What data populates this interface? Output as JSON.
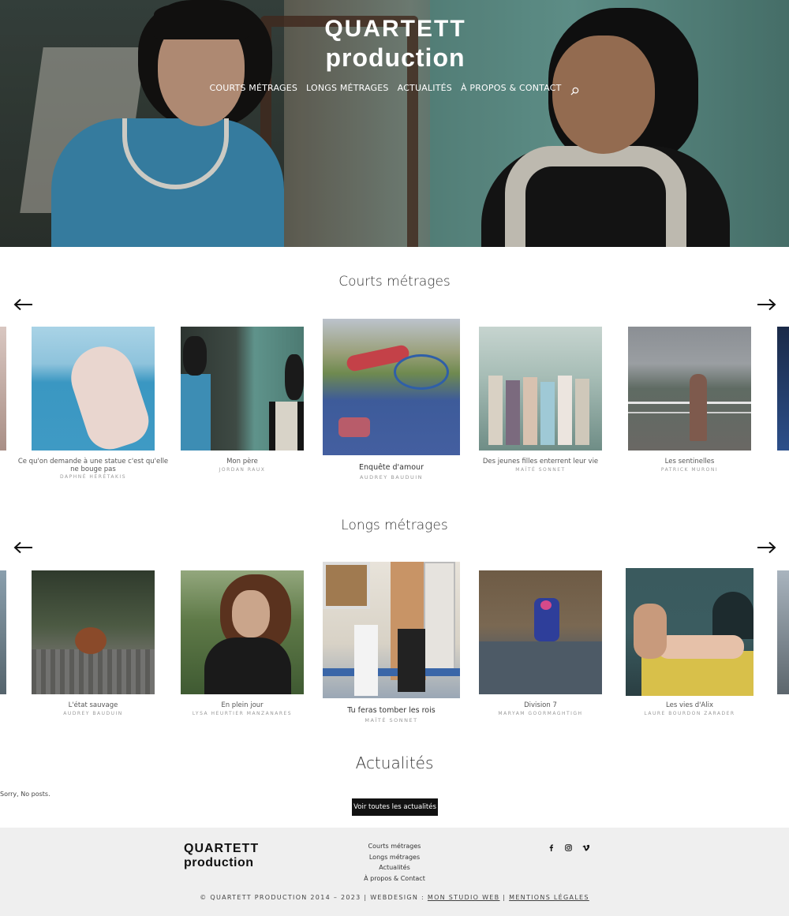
{
  "brand": {
    "line1": "QUARTETT",
    "line2": "production"
  },
  "nav": {
    "items": [
      "COURTS MÉTRAGES",
      "LONGS MÉTRAGES",
      "ACTUALITÉS",
      "À PROPOS & CONTACT"
    ]
  },
  "courts": {
    "title": "Courts métrages",
    "films": [
      {
        "title": "Ce qu'on demande à une statue c'est qu'elle ne bouge pas",
        "author": "DAPHNÉ HÉRÉTAKIS"
      },
      {
        "title": "Mon père",
        "author": "JORDAN RAUX"
      },
      {
        "title": "Enquête d'amour",
        "author": "AUDREY BAUDUIN"
      },
      {
        "title": "Des jeunes filles enterrent leur vie",
        "author": "MAÏTÉ SONNET"
      },
      {
        "title": "Les sentinelles",
        "author": "PATRICK MURONI"
      }
    ]
  },
  "longs": {
    "title": "Longs métrages",
    "films": [
      {
        "title": "L'état sauvage",
        "author": "AUDREY BAUDUIN"
      },
      {
        "title": "En plein jour",
        "author": "LYSA HEURTIER MANZANARES"
      },
      {
        "title": "Tu feras tomber les rois",
        "author": "MAÏTÉ SONNET"
      },
      {
        "title": "Division 7",
        "author": "MARYAM GOORMAGHTIGH"
      },
      {
        "title": "Les vies d'Alix",
        "author": "LAURE BOURDON ZARADER"
      }
    ]
  },
  "news": {
    "title": "Actualités",
    "empty": "Sorry, No posts.",
    "button": "Voir toutes les actualités"
  },
  "footer": {
    "links": [
      "Courts métrages",
      "Longs métrages",
      "Actualités",
      "À propos & Contact"
    ],
    "social": [
      "facebook-icon",
      "instagram-icon",
      "vimeo-icon"
    ],
    "copy_prefix": "© QUARTETT PRODUCTION 2014 – 2023 | WEBDESIGN : ",
    "studio": "MON STUDIO WEB",
    "sep": " | ",
    "legal": "MENTIONS LÉGALES"
  }
}
